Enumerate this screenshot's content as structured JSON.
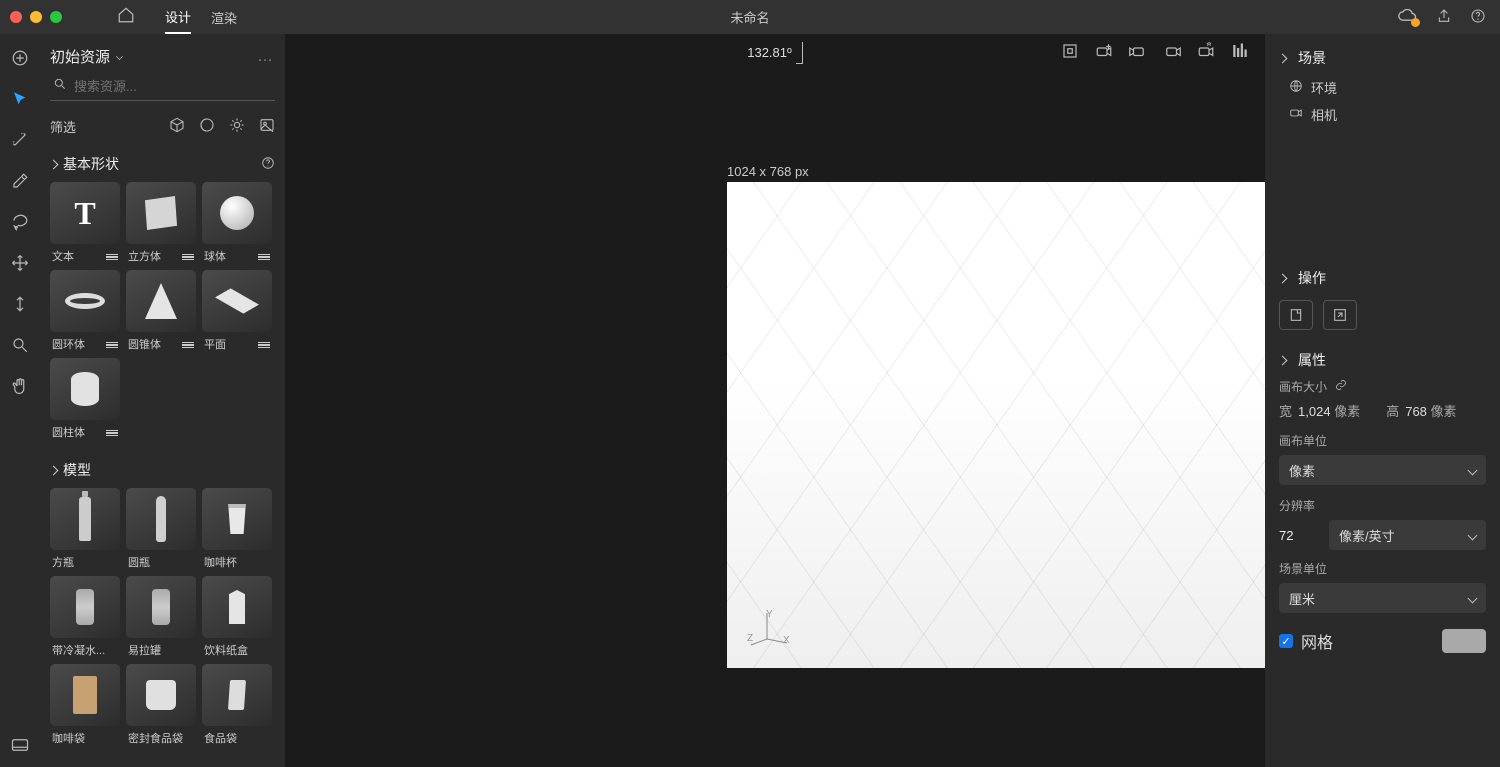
{
  "title_bar": {
    "tabs": {
      "design": "设计",
      "render": "渲染"
    },
    "document_title": "未命名"
  },
  "assets_panel": {
    "library_name": "初始资源",
    "search_placeholder": "搜索资源...",
    "filter_label": "筛选",
    "section_basic_shapes": "基本形状",
    "section_models": "模型",
    "basic_shapes": {
      "text": "文本",
      "cube": "立方体",
      "sphere": "球体",
      "torus": "圆环体",
      "cone": "圆锥体",
      "plane": "平面",
      "cylinder": "圆柱体"
    },
    "models": {
      "square_bottle": "方瓶",
      "round_bottle": "圆瓶",
      "coffee_cup": "咖啡杯",
      "condensed_can": "带冷凝水...",
      "soda_can": "易拉罐",
      "beverage_carton": "饮料纸盒",
      "coffee_bag": "咖啡袋",
      "sealed_pouch": "密封食品袋",
      "food_bag": "食品袋"
    }
  },
  "viewport": {
    "canvas_label": "1024 x 768 px",
    "zoom": "132.81º",
    "gizmo": {
      "x": "X",
      "y": "Y",
      "z": "Z"
    }
  },
  "right_panel": {
    "scene_title": "场景",
    "env_item": "环境",
    "camera_item": "相机",
    "ops_title": "操作",
    "props_title": "属性",
    "canvas_size_label": "画布大小",
    "width_label": "宽",
    "width_value": "1,024",
    "width_unit": "像素",
    "height_label": "高",
    "height_value": "768",
    "height_unit": "像素",
    "canvas_unit_label": "画布单位",
    "canvas_unit_value": "像素",
    "resolution_label": "分辨率",
    "resolution_value": "72",
    "resolution_unit": "像素/英寸",
    "scene_unit_label": "场景单位",
    "scene_unit_value": "厘米",
    "grid_label": "网格"
  }
}
